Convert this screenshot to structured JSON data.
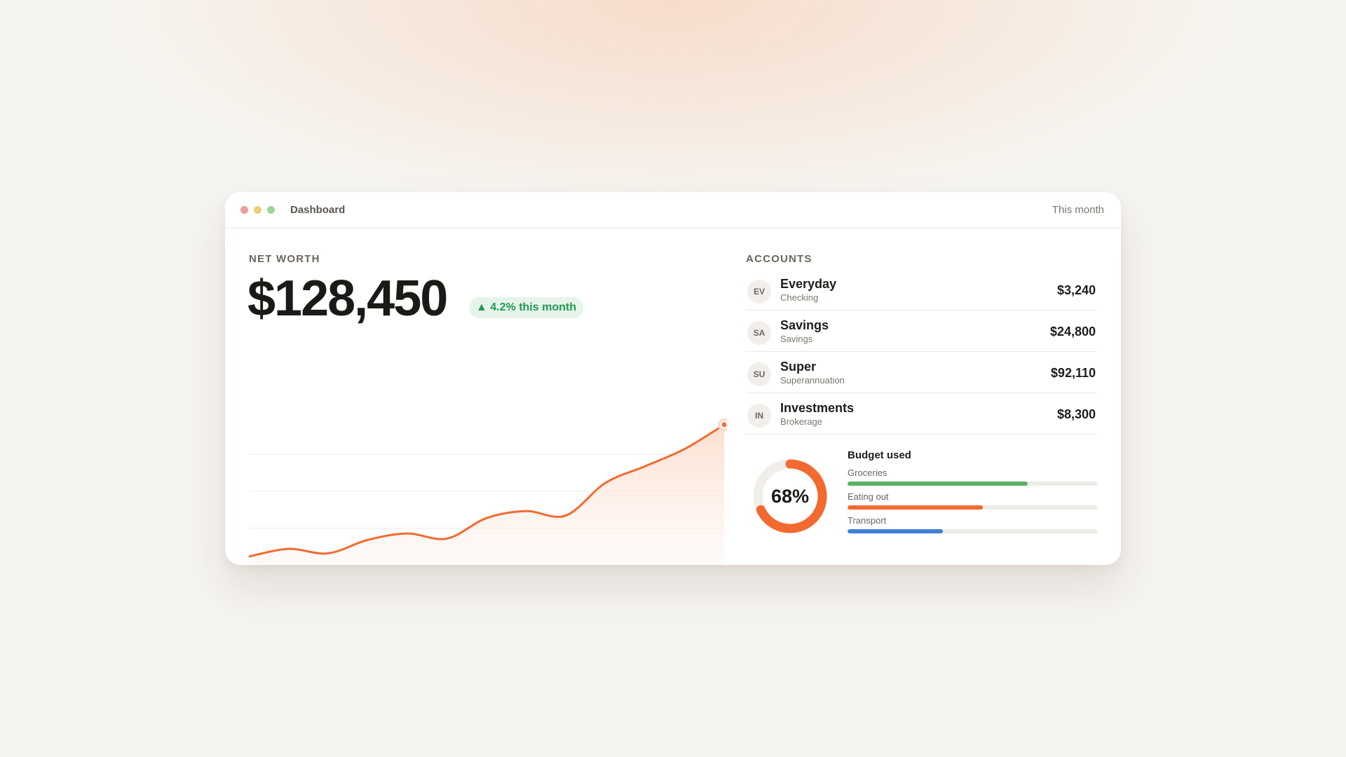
{
  "window": {
    "title": "Dashboard",
    "period": "This month"
  },
  "net_worth": {
    "label": "NET WORTH",
    "value": "$128,450",
    "change": "▲ 4.2% this month"
  },
  "chart_data": {
    "type": "area",
    "title": "",
    "xlabel": "",
    "ylabel": "",
    "x": [
      0,
      1,
      2,
      3,
      4,
      5,
      6,
      7,
      8,
      9,
      10,
      11,
      12
    ],
    "values": [
      0,
      12,
      5,
      26,
      36,
      28,
      60,
      71,
      64,
      115,
      141,
      168,
      206
    ],
    "ylim": [
      0,
      230
    ],
    "grid": true,
    "line_color": "#f26a2f",
    "fill_color": "#fde4d8"
  },
  "accounts": {
    "label": "ACCOUNTS",
    "items": [
      {
        "initials": "EV",
        "name": "Everyday",
        "type": "Checking",
        "amount": "$3,240"
      },
      {
        "initials": "SA",
        "name": "Savings",
        "type": "Savings",
        "amount": "$24,800"
      },
      {
        "initials": "SU",
        "name": "Super",
        "type": "Superannuation",
        "amount": "$92,110"
      },
      {
        "initials": "IN",
        "name": "Investments",
        "type": "Brokerage",
        "amount": "$8,300"
      }
    ]
  },
  "budget": {
    "donut_label": "68%",
    "donut_fraction": 0.68,
    "donut_color": "#f26a2f",
    "title": "Budget used",
    "items": [
      {
        "label": "Groceries",
        "fraction": 0.72,
        "color": "#5bb263"
      },
      {
        "label": "Eating out",
        "fraction": 0.54,
        "color": "#f26a2f"
      },
      {
        "label": "Transport",
        "fraction": 0.38,
        "color": "#3f7fd9"
      }
    ]
  }
}
